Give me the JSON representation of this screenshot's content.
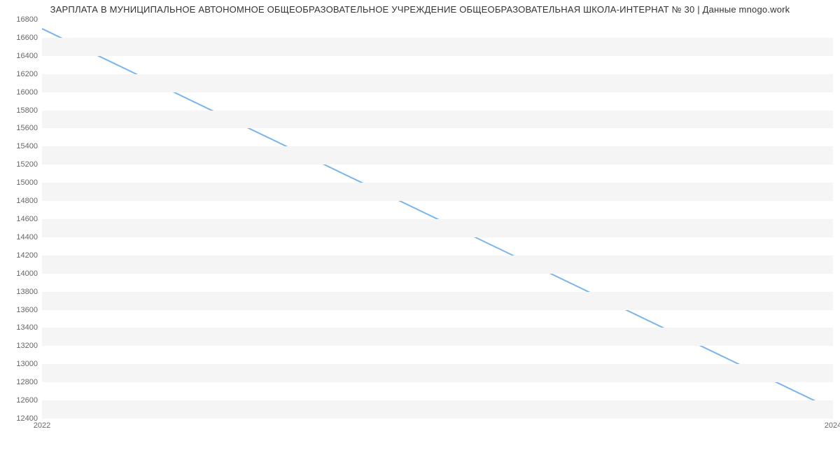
{
  "chart_data": {
    "type": "line",
    "title": "ЗАРПЛАТА В МУНИЦИПАЛЬНОЕ АВТОНОМНОЕ ОБЩЕОБРАЗОВАТЕЛЬНОЕ УЧРЕЖДЕНИЕ ОБЩЕОБРАЗОВАТЕЛЬНАЯ ШКОЛА-ИНТЕРНАТ № 30 | Данные mnogo.work",
    "xlabel": "",
    "ylabel": "",
    "x": [
      2022,
      2024
    ],
    "values": [
      16700,
      12500
    ],
    "x_ticks": [
      2022,
      2024
    ],
    "y_ticks": [
      12400,
      12600,
      12800,
      13000,
      13200,
      13400,
      13600,
      13800,
      14000,
      14200,
      14400,
      14600,
      14800,
      15000,
      15200,
      15400,
      15600,
      15800,
      16000,
      16200,
      16400,
      16600,
      16800
    ],
    "ylim": [
      12400,
      16800
    ],
    "xlim": [
      2022,
      2024
    ],
    "grid": "banded",
    "series_color": "#7cb5ec"
  }
}
